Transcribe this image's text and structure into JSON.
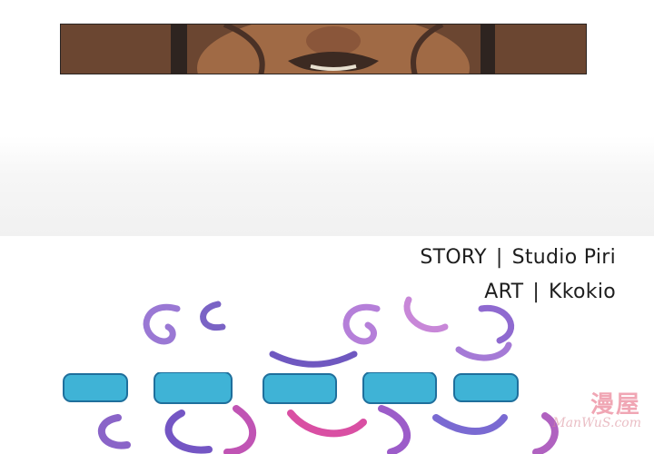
{
  "credits": {
    "story_label": "STORY",
    "story_value": "Studio Piri",
    "art_label": "ART",
    "art_value": "Kkokio",
    "separator": "|"
  },
  "watermark": {
    "site_name": "漫屋",
    "site_url": "ManWuS.com"
  },
  "colors": {
    "logo_purple": "#8a64c8",
    "logo_teal": "#3fb3d6",
    "logo_pink": "#d94fa3",
    "watermark": "#e45e78"
  }
}
